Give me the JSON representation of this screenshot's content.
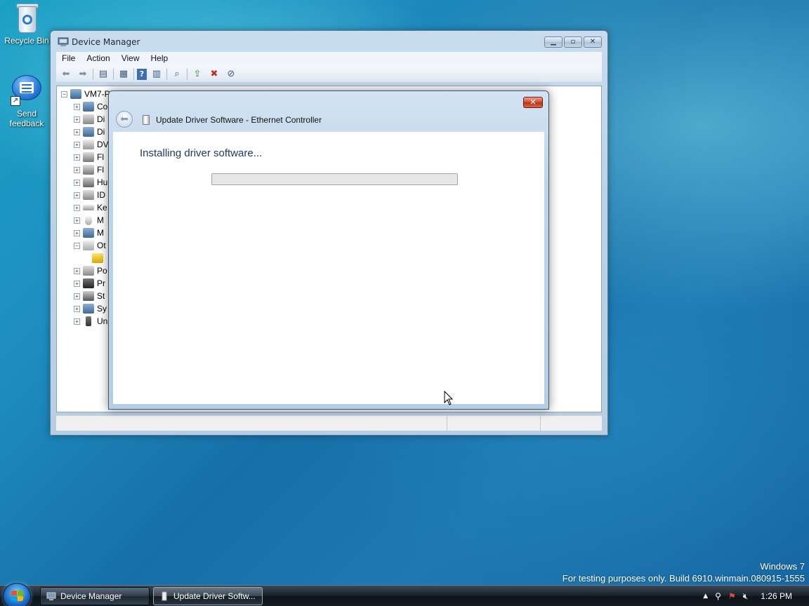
{
  "desktop": {
    "icons": [
      {
        "label": "Recycle Bin"
      },
      {
        "label": "Send feedback"
      }
    ],
    "watermark": {
      "line1": "Windows 7",
      "line2": "For testing purposes only. Build 6910.winmain.080915-1555"
    }
  },
  "device_manager": {
    "title": "Device Manager",
    "menu": [
      "File",
      "Action",
      "View",
      "Help"
    ],
    "tree": {
      "root": "VM7-P",
      "items": [
        "Co",
        "Di",
        "Di",
        "DV",
        "Fl",
        "Fl",
        "Hu",
        "ID",
        "Ke",
        "M",
        "M",
        "Ot",
        "",
        "Po",
        "Pr",
        "St",
        "Sy",
        "Un"
      ]
    }
  },
  "dialog": {
    "title": "Update Driver Software - Ethernet Controller",
    "status": "Installing driver software...",
    "progress": 0.0
  },
  "taskbar": {
    "buttons": [
      {
        "label": "Device Manager"
      },
      {
        "label": "Update Driver Softw..."
      }
    ],
    "clock": "1:26 PM"
  }
}
